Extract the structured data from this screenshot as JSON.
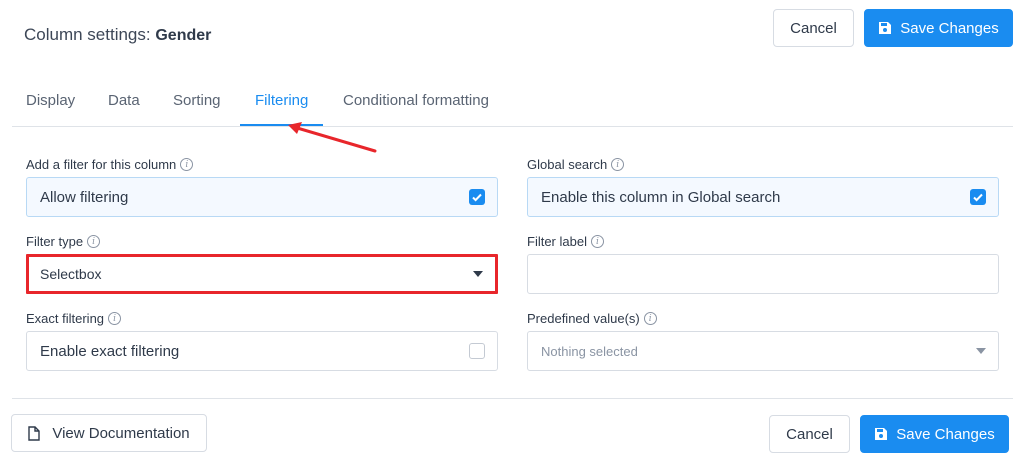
{
  "header": {
    "title_prefix": "Column settings:",
    "column_name": "Gender",
    "cancel_label": "Cancel",
    "save_label": "Save Changes"
  },
  "tabs": [
    {
      "label": "Display",
      "active": false
    },
    {
      "label": "Data",
      "active": false
    },
    {
      "label": "Sorting",
      "active": false
    },
    {
      "label": "Filtering",
      "active": true
    },
    {
      "label": "Conditional formatting",
      "active": false
    }
  ],
  "fields": {
    "add_filter": {
      "label": "Add a filter for this column",
      "value": "Allow filtering",
      "checked": true
    },
    "global_search": {
      "label": "Global search",
      "value": "Enable this column in Global search",
      "checked": true
    },
    "filter_type": {
      "label": "Filter type",
      "value": "Selectbox"
    },
    "filter_label": {
      "label": "Filter label",
      "value": ""
    },
    "exact_filtering": {
      "label": "Exact filtering",
      "value": "Enable exact filtering",
      "checked": false
    },
    "predefined_values": {
      "label": "Predefined value(s)",
      "placeholder": "Nothing selected"
    }
  },
  "footer": {
    "doc_label": "View Documentation",
    "cancel_label": "Cancel",
    "save_label": "Save Changes"
  },
  "colors": {
    "accent": "#1a8cf0",
    "annotation": "#e8262b"
  },
  "icons": {
    "save": "floppy-disk-icon",
    "document": "document-icon",
    "info": "info-circle-icon",
    "checkbox": "checkbox-icon",
    "dropdown": "caret-down-icon"
  }
}
